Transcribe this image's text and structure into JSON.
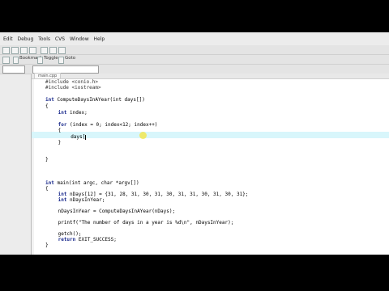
{
  "menu": [
    "Edit",
    "Debug",
    "Tools",
    "CVS",
    "Window",
    "Help"
  ],
  "toolbar": {
    "bookmark_label": "Bookmark",
    "toggle_label": "Toggle",
    "goto_label": "Goto"
  },
  "editor": {
    "tab_label": "main.cpp",
    "lines": [
      {
        "text": "#include <conio.h>"
      },
      {
        "text": "#include <iostream>"
      },
      {
        "text": ""
      },
      {
        "kw": "int",
        "text": " ComputeDaysInAYear(int days[])"
      },
      {
        "text": "{"
      },
      {
        "kw": "int",
        "text": " index;"
      },
      {
        "text": ""
      },
      {
        "kw": "for",
        "text": " (index = 0; index<12; index++)"
      },
      {
        "text": "{"
      },
      {
        "text": "days["
      },
      {
        "text": "}"
      },
      {
        "text": ""
      },
      {
        "text": ""
      },
      {
        "text": "}"
      },
      {
        "text": ""
      },
      {
        "text": ""
      },
      {
        "text": ""
      },
      {
        "kw": "int",
        "text": " main(int argc, char *argv[])"
      },
      {
        "text": "{"
      },
      {
        "kw": "int",
        "text": " nDays[12] = {31, 28, 31, 30, 31, 30, 31, 31, 30, 31, 30, 31};"
      },
      {
        "kw": "int",
        "text": " nDaysInYear;"
      },
      {
        "text": ""
      },
      {
        "text": "nDaysInYear = ComputeDaysInAYear(nDays);"
      },
      {
        "text": ""
      },
      {
        "text": "printf(\"The number of days in a year is %d\\n\", nDaysInYear);"
      },
      {
        "text": ""
      },
      {
        "text": "getch();"
      },
      {
        "kw": "return",
        "text": " EXIT_SUCCESS;"
      },
      {
        "text": "}"
      }
    ]
  }
}
